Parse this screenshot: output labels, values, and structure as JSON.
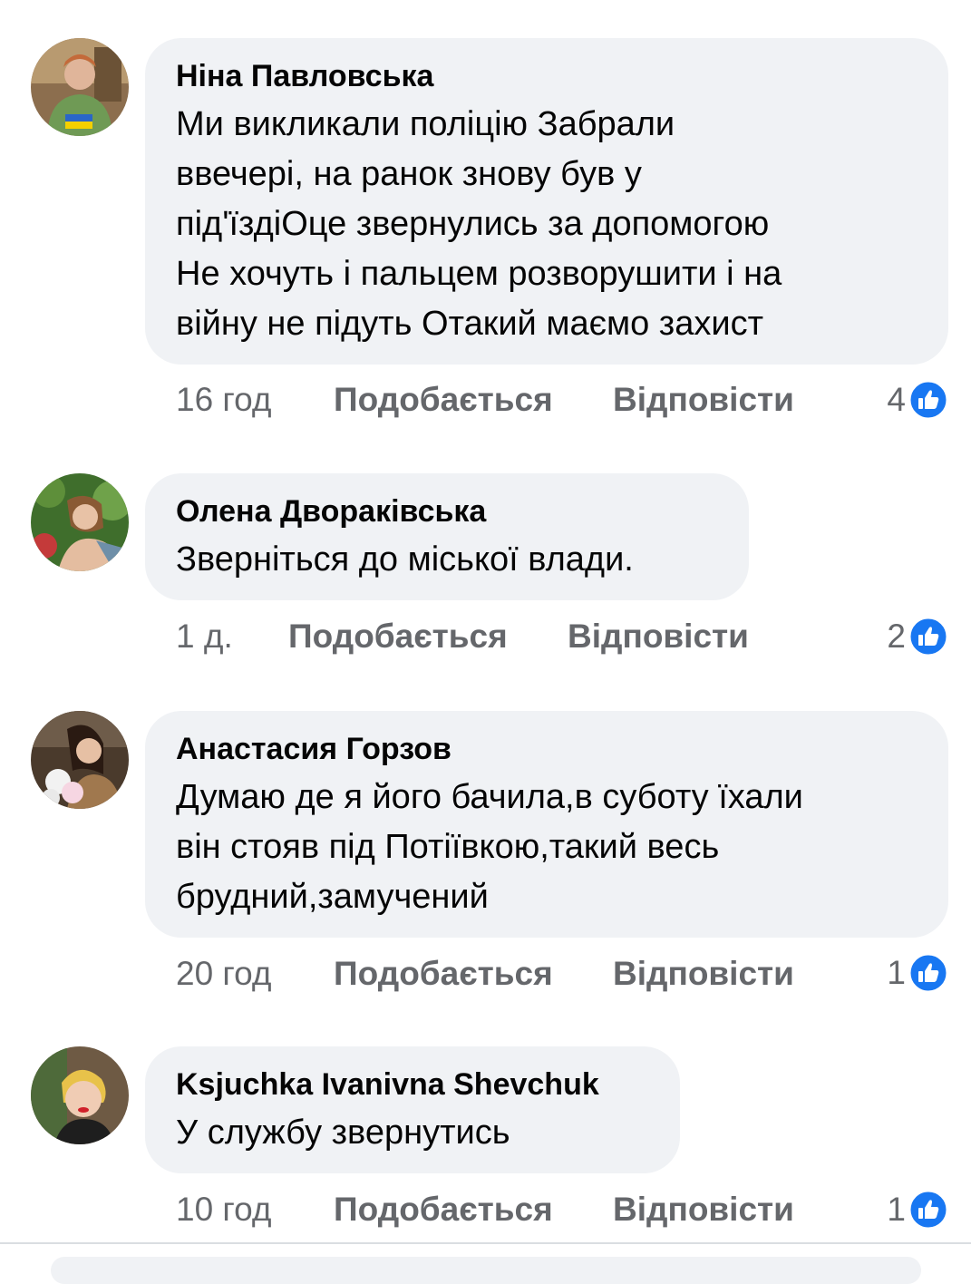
{
  "comments": [
    {
      "author": "Ніна Павловська",
      "lines": [
        "Ми викликали поліцію  Забрали",
        "ввечері, на ранок знову був у",
        "під'їздіОце звернулись за допомогою",
        "Не хочуть і пальцем розворушити і на",
        "війну не підуть Отакий маємо захист"
      ],
      "time": "16 год",
      "like_label": "Подобається",
      "reply_label": "Відповісти",
      "reaction_count": "4",
      "reaction_icon": "like-icon"
    },
    {
      "author": "Олена Дворaківська",
      "lines": [
        "Зверніться до міської влади."
      ],
      "time": "1 д.",
      "like_label": "Подобається",
      "reply_label": "Відповісти",
      "reaction_count": "2",
      "reaction_icon": "like-icon"
    },
    {
      "author": "Анастасия Горзов",
      "lines": [
        "Думаю де я його бачила,в суботу їхали",
        "він стояв під Потіївкою,такий весь",
        "брудний,замучений"
      ],
      "time": "20 год",
      "like_label": "Подобається",
      "reply_label": "Відповісти",
      "reaction_count": "1",
      "reaction_icon": "like-icon"
    },
    {
      "author": "Ksjuchka Ivanivna Shevchuk",
      "lines": [
        "У службу звернутись"
      ],
      "time": "10 год",
      "like_label": "Подобається",
      "reply_label": "Відповісти",
      "reaction_count": "1",
      "reaction_icon": "like-icon"
    }
  ],
  "colors": {
    "bubble": "#f0f2f5",
    "meta_text": "#65676b",
    "like_blue": "#1877f2"
  }
}
